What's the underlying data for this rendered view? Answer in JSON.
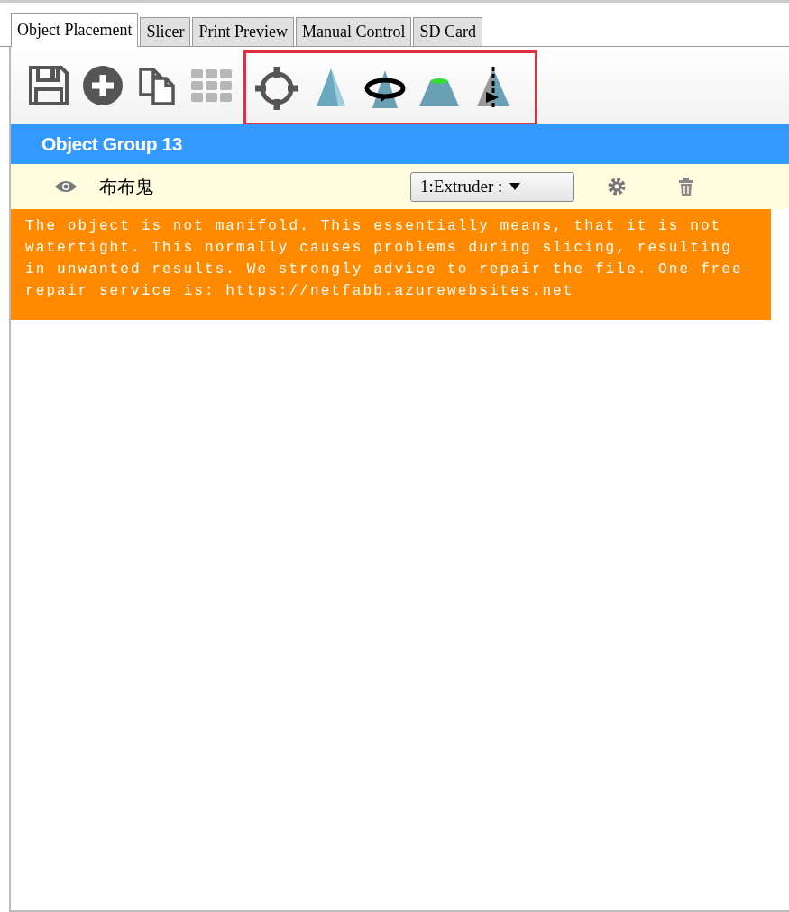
{
  "tabs": [
    {
      "label": "Object Placement",
      "selected": true
    },
    {
      "label": "Slicer",
      "selected": false
    },
    {
      "label": "Print Preview",
      "selected": false
    },
    {
      "label": "Manual Control",
      "selected": false
    },
    {
      "label": "SD Card",
      "selected": false
    }
  ],
  "toolbar": [
    {
      "kind": "save",
      "disabled": false
    },
    {
      "kind": "add",
      "disabled": false
    },
    {
      "kind": "copy",
      "disabled": false
    },
    {
      "kind": "grid",
      "disabled": true
    }
  ],
  "highlighted_tools": [
    {
      "kind": "move",
      "disabled": false
    },
    {
      "kind": "scale",
      "disabled": false
    },
    {
      "kind": "rotate",
      "disabled": false
    },
    {
      "kind": "cut",
      "disabled": false
    },
    {
      "kind": "mirror",
      "disabled": false
    }
  ],
  "group": {
    "title": "Object Group 13"
  },
  "objects": [
    {
      "name": "布布鬼",
      "visible": true,
      "extruder": "1:Extruder :"
    }
  ],
  "warning": "The object is not manifold. This essentially means, that it is not watertight. This normally causes problems during slicing, resulting in unwanted results. We strongly advice to repair the file. One free repair service is: https://netfabb.azurewebsites.net"
}
